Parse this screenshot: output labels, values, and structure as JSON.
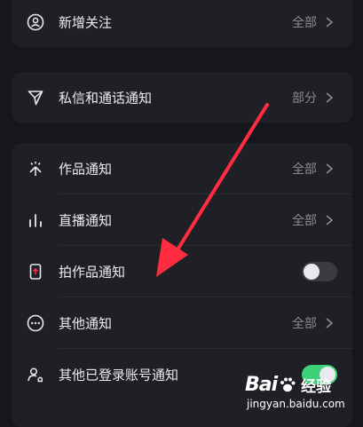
{
  "rows": {
    "new_follow": {
      "label": "新增关注",
      "value": "全部"
    },
    "dm_call": {
      "label": "私信和通话通知",
      "value": "部分"
    },
    "works": {
      "label": "作品通知",
      "value": "全部"
    },
    "live": {
      "label": "直播通知",
      "value": "全部"
    },
    "shoot": {
      "label": "拍作品通知",
      "enabled": false
    },
    "other": {
      "label": "其他通知",
      "value": "全部"
    },
    "other_account": {
      "label": "其他已登录账号通知",
      "enabled": true
    }
  },
  "colors": {
    "accent": "#ff2d3f",
    "toggle_on": "#3fd07a",
    "toggle_off": "#3a3b42"
  },
  "watermark": {
    "brand_a": "Bai",
    "brand_b": "经验",
    "url": "jingyan.baidu.com"
  }
}
